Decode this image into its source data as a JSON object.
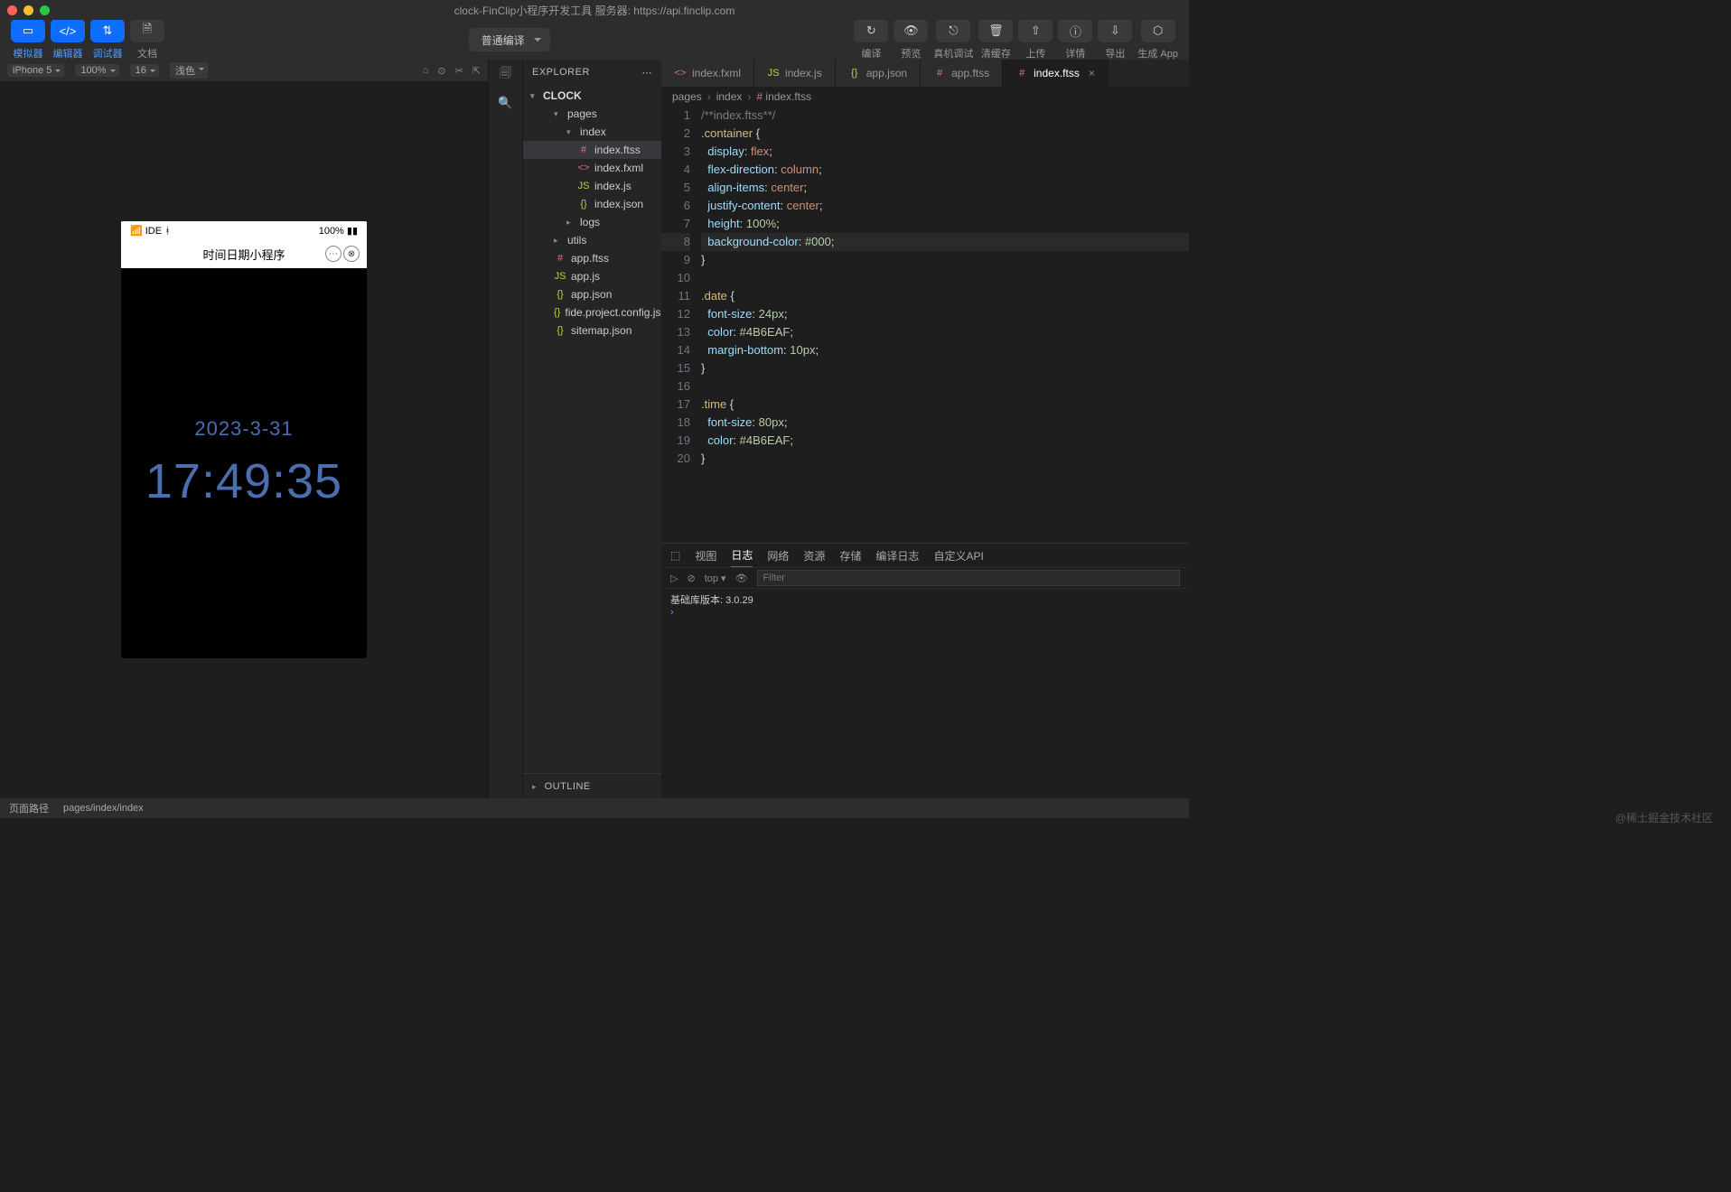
{
  "titlebar": {
    "title": "clock-FinClip小程序开发工具 服务器: https://api.finclip.com"
  },
  "toolbar": {
    "left": [
      {
        "icon": "▭",
        "label": "模拟器"
      },
      {
        "icon": "</>",
        "label": "编辑器"
      },
      {
        "icon": "⇅",
        "label": "调试器"
      },
      {
        "icon": "🗎",
        "label": "文档"
      }
    ],
    "compile_mode": "普通编译",
    "right": [
      {
        "icon": "↻",
        "label": "编译"
      },
      {
        "icon": "👁",
        "label": "预览"
      },
      {
        "icon": "⎋",
        "label": "真机调试"
      },
      {
        "icon": "🗑",
        "label": "清缓存"
      },
      {
        "icon": "⇧",
        "label": "上传"
      },
      {
        "icon": "ⓘ",
        "label": "详情"
      },
      {
        "icon": "⇩",
        "label": "导出"
      },
      {
        "icon": "⬡",
        "label": "生成 App"
      }
    ]
  },
  "simulator": {
    "device": "iPhone 5",
    "zoom": "100%",
    "font": "16",
    "theme": "浅色",
    "phone": {
      "status_left": "📶 IDE ᚼ",
      "status_right": "100% ▮▮",
      "nav_title": "时间日期小程序",
      "date": "2023-3-31",
      "time": "17:49:35"
    }
  },
  "explorer": {
    "header": "EXPLORER",
    "root": "CLOCK",
    "tree": [
      {
        "name": "pages",
        "type": "folder",
        "depth": 0,
        "open": true
      },
      {
        "name": "index",
        "type": "folder",
        "depth": 1,
        "open": true
      },
      {
        "name": "index.ftss",
        "type": "ftss",
        "depth": 2,
        "active": true
      },
      {
        "name": "index.fxml",
        "type": "fxml",
        "depth": 2
      },
      {
        "name": "index.js",
        "type": "js",
        "depth": 2
      },
      {
        "name": "index.json",
        "type": "json",
        "depth": 2
      },
      {
        "name": "logs",
        "type": "folder",
        "depth": 1,
        "open": false
      },
      {
        "name": "utils",
        "type": "folder",
        "depth": 0,
        "open": false
      },
      {
        "name": "app.ftss",
        "type": "ftss",
        "depth": -1
      },
      {
        "name": "app.js",
        "type": "js",
        "depth": -1
      },
      {
        "name": "app.json",
        "type": "json",
        "depth": -1
      },
      {
        "name": "fide.project.config.json",
        "type": "json",
        "depth": -1
      },
      {
        "name": "sitemap.json",
        "type": "json",
        "depth": -1
      }
    ],
    "outline": "OUTLINE"
  },
  "editor": {
    "tabs": [
      {
        "name": "index.fxml",
        "icon": "fxml"
      },
      {
        "name": "index.js",
        "icon": "js"
      },
      {
        "name": "app.json",
        "icon": "json"
      },
      {
        "name": "app.ftss",
        "icon": "ftss"
      },
      {
        "name": "index.ftss",
        "icon": "ftss",
        "active": true,
        "close": true
      }
    ],
    "breadcrumb": [
      "pages",
      "index",
      "index.ftss"
    ],
    "code": [
      {
        "n": 1,
        "h": "<span class='c-comment'>/**index.ftss**/</span>"
      },
      {
        "n": 2,
        "h": "<span class='c-sel'>.container</span> <span class='c-punc'>{</span>"
      },
      {
        "n": 3,
        "h": "  <span class='c-prop'>display</span><span class='c-punc'>:</span> <span class='c-val'>flex</span><span class='c-punc'>;</span>"
      },
      {
        "n": 4,
        "h": "  <span class='c-prop'>flex-direction</span><span class='c-punc'>:</span> <span class='c-val'>column</span><span class='c-punc'>;</span>"
      },
      {
        "n": 5,
        "h": "  <span class='c-prop'>align-items</span><span class='c-punc'>:</span> <span class='c-val'>center</span><span class='c-punc'>;</span>"
      },
      {
        "n": 6,
        "h": "  <span class='c-prop'>justify-content</span><span class='c-punc'>:</span> <span class='c-val'>center</span><span class='c-punc'>;</span>"
      },
      {
        "n": 7,
        "h": "  <span class='c-prop'>height</span><span class='c-punc'>:</span> <span class='c-num'>100%</span><span class='c-punc'>;</span>"
      },
      {
        "n": 8,
        "h": "  <span class='c-prop'>background-color</span><span class='c-punc'>:</span> <span class='c-num'>#000</span><span class='c-punc'>;</span>",
        "hl": true
      },
      {
        "n": 9,
        "h": "<span class='c-punc'>}</span>"
      },
      {
        "n": 10,
        "h": ""
      },
      {
        "n": 11,
        "h": "<span class='c-sel'>.date</span> <span class='c-punc'>{</span>"
      },
      {
        "n": 12,
        "h": "  <span class='c-prop'>font-size</span><span class='c-punc'>:</span> <span class='c-num'>24px</span><span class='c-punc'>;</span>"
      },
      {
        "n": 13,
        "h": "  <span class='c-prop'>color</span><span class='c-punc'>:</span> <span class='c-num'>#4B6EAF</span><span class='c-punc'>;</span>"
      },
      {
        "n": 14,
        "h": "  <span class='c-prop'>margin-bottom</span><span class='c-punc'>:</span> <span class='c-num'>10px</span><span class='c-punc'>;</span>"
      },
      {
        "n": 15,
        "h": "<span class='c-punc'>}</span>"
      },
      {
        "n": 16,
        "h": ""
      },
      {
        "n": 17,
        "h": "<span class='c-sel'>.time</span> <span class='c-punc'>{</span>"
      },
      {
        "n": 18,
        "h": "  <span class='c-prop'>font-size</span><span class='c-punc'>:</span> <span class='c-num'>80px</span><span class='c-punc'>;</span>"
      },
      {
        "n": 19,
        "h": "  <span class='c-prop'>color</span><span class='c-punc'>:</span> <span class='c-num'>#4B6EAF</span><span class='c-punc'>;</span>"
      },
      {
        "n": 20,
        "h": "<span class='c-punc'>}</span>"
      }
    ]
  },
  "console": {
    "tabs": [
      "视图",
      "日志",
      "网络",
      "资源",
      "存储",
      "编译日志",
      "自定义API"
    ],
    "active_tab": 1,
    "context": "top",
    "filter_placeholder": "Filter",
    "body_line": "基础库版本: 3.0.29"
  },
  "statusbar": {
    "left1": "页面路径",
    "left2": "pages/index/index"
  },
  "watermark": "@稀土掘金技术社区"
}
